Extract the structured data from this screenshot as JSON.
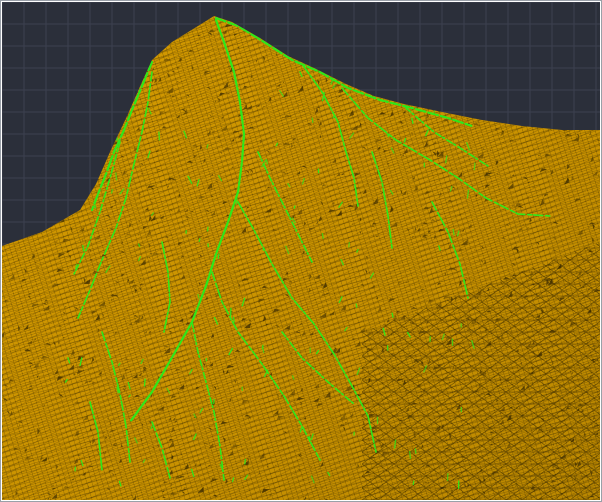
{
  "viewport": {
    "background_color": "#2b2f3a",
    "grid_color": "#3c4150",
    "mesh_fill_color": "#d49a00",
    "mesh_wire_color": "#3a2a00",
    "ridge_edge_color": "#2ee81a",
    "grid_visible": true
  },
  "icons": {
    "terrain": "terrain-mesh-icon"
  }
}
